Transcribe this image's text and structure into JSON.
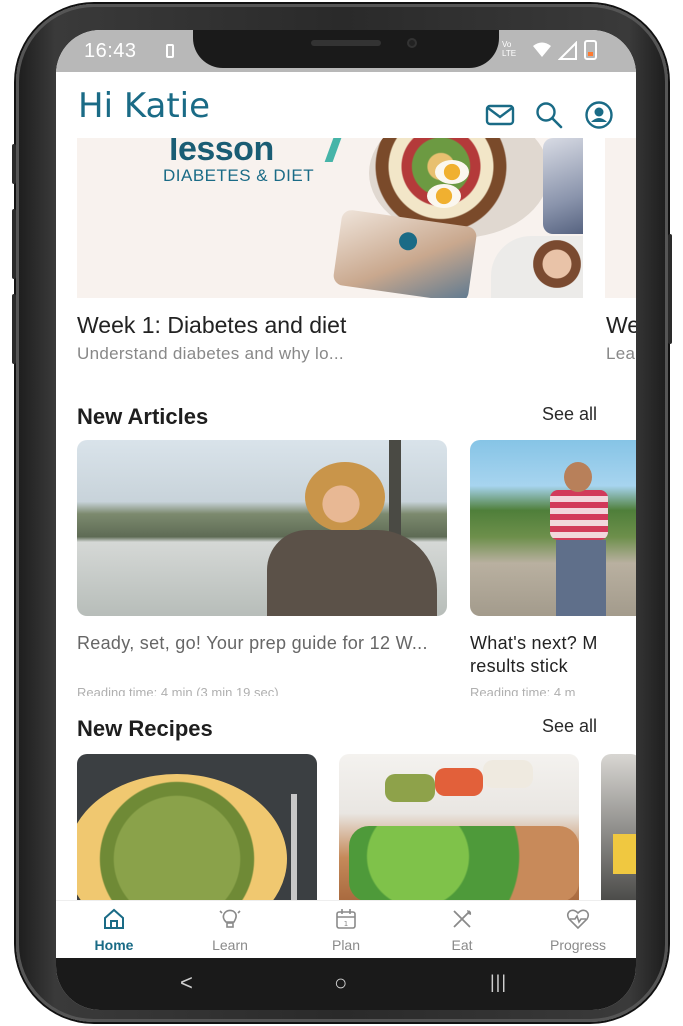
{
  "status_bar": {
    "time": "16:43",
    "network_label": "VoLTE\nLTE"
  },
  "header": {
    "greeting": "Hi Katie",
    "icons": [
      "mail-icon",
      "search-icon",
      "profile-icon"
    ]
  },
  "lesson_banner": {
    "word": "lesson",
    "subtitle": "DIABETES & DIET"
  },
  "lessons": [
    {
      "title": "Week 1: Diabetes and diet",
      "description": "Understand diabetes and why lo..."
    },
    {
      "title": "We",
      "description": "Lea"
    }
  ],
  "articles_section": {
    "title": "New Articles",
    "see_all": "See all",
    "items": [
      {
        "title": "Ready, set, go! Your prep guide for 12 W...",
        "meta": "Reading time: 4 min (3 min 19 sec)"
      },
      {
        "title": "What's next? M results stick",
        "meta": "Reading time: 4 m"
      }
    ]
  },
  "recipes_section": {
    "title": "New Recipes",
    "see_all": "See all"
  },
  "bottom_nav": {
    "items": [
      {
        "label": "Home",
        "icon": "home-icon",
        "active": true
      },
      {
        "label": "Learn",
        "icon": "lightbulb-icon",
        "active": false
      },
      {
        "label": "Plan",
        "icon": "calendar-icon",
        "active": false
      },
      {
        "label": "Eat",
        "icon": "utensils-icon",
        "active": false
      },
      {
        "label": "Progress",
        "icon": "heart-pulse-icon",
        "active": false
      }
    ]
  },
  "system_nav": {
    "back": "<",
    "home": "○",
    "recents": "|||"
  },
  "colors": {
    "brand_teal": "#1a6b86",
    "accent_mint": "#46b4a8",
    "text_dark": "#1e1e1e",
    "text_muted": "#888888"
  }
}
